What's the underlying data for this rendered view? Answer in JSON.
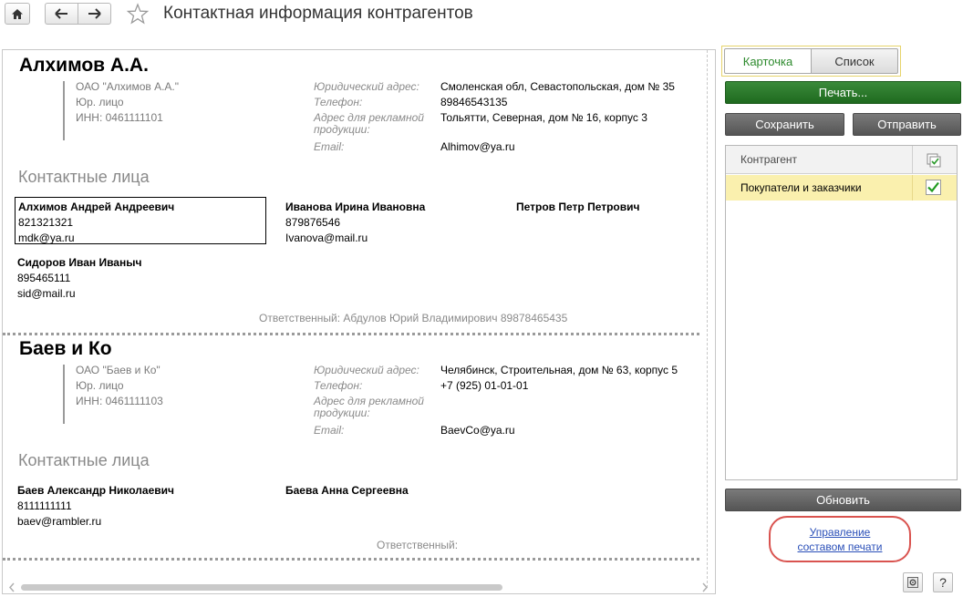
{
  "window": {
    "title": "Контактная информация контрагентов"
  },
  "nav": {
    "home_icon": "home-icon",
    "back_icon": "arrow-left-icon",
    "forward_icon": "arrow-right-icon",
    "favorite_icon": "star-icon"
  },
  "companies": [
    {
      "name": "Алхимов А.А.",
      "requisites": [
        "ОАО \"Алхимов А.А.\"",
        "Юр. лицо",
        "ИНН: 0461111101"
      ],
      "fields": {
        "legal_address_label": "Юридический адрес:",
        "legal_address": "Смоленская обл, Севастопольская, дом № 35",
        "phone_label": "Телефон:",
        "phone": "89846543135",
        "ad_address_label": "Адрес для рекламной продукции:",
        "ad_address": "Тольятти, Северная, дом № 16, корпус 3",
        "email_label": "Email:",
        "email": "Alhimov@ya.ru"
      },
      "contacts_title": "Контактные лица",
      "contacts": [
        {
          "name": "Алхимов Андрей Андреевич",
          "phone": "821321321",
          "email": "mdk@ya.ru"
        },
        {
          "name": "Иванова Ирина Ивановна",
          "phone": "879876546",
          "email": "Ivanova@mail.ru"
        },
        {
          "name": "Петров Петр Петрович",
          "phone": "",
          "email": ""
        },
        {
          "name": "Сидоров Иван Иваныч",
          "phone": "895465111",
          "email": "sid@mail.ru"
        }
      ],
      "responsible": "Ответственный: Абдулов Юрий Владимирович 89878465435"
    },
    {
      "name": "Баев и Ко",
      "requisites": [
        "ОАО \"Баев и Ко\"",
        "Юр. лицо",
        "ИНН: 0461111103"
      ],
      "fields": {
        "legal_address_label": "Юридический адрес:",
        "legal_address": "Челябинск, Строительная, дом № 63, корпус 5",
        "phone_label": "Телефон:",
        "phone": "+7 (925) 01-01-01",
        "ad_address_label": "Адрес для рекламной продукции:",
        "ad_address": "",
        "email_label": "Email:",
        "email": "BaevCo@ya.ru"
      },
      "contacts_title": "Контактные лица",
      "contacts": [
        {
          "name": "Баев Александр Николаевич",
          "phone": "8111111111",
          "email": "baev@rambler.ru"
        },
        {
          "name": "Баева Анна Сергеевна",
          "phone": "",
          "email": ""
        }
      ],
      "responsible": "Ответственный:"
    }
  ],
  "panel": {
    "mode_card": "Карточка",
    "mode_list": "Список",
    "print": "Печать...",
    "save": "Сохранить",
    "send": "Отправить",
    "filter_header": "Контрагент",
    "filter_header_icon": "select-all-icon",
    "filter_rows": [
      {
        "label": "Покупатели и заказчики",
        "checked": true
      }
    ],
    "refresh": "Обновить",
    "manage_link_line1": "Управление",
    "manage_link_line2": "составом печати",
    "settings_icon": "settings-icon",
    "help_label": "?"
  },
  "colors": {
    "print_green": "#2a7a2a",
    "selected_row": "#faf0ae",
    "link_blue": "#2a4fb8",
    "highlight_red": "#d9534f"
  }
}
